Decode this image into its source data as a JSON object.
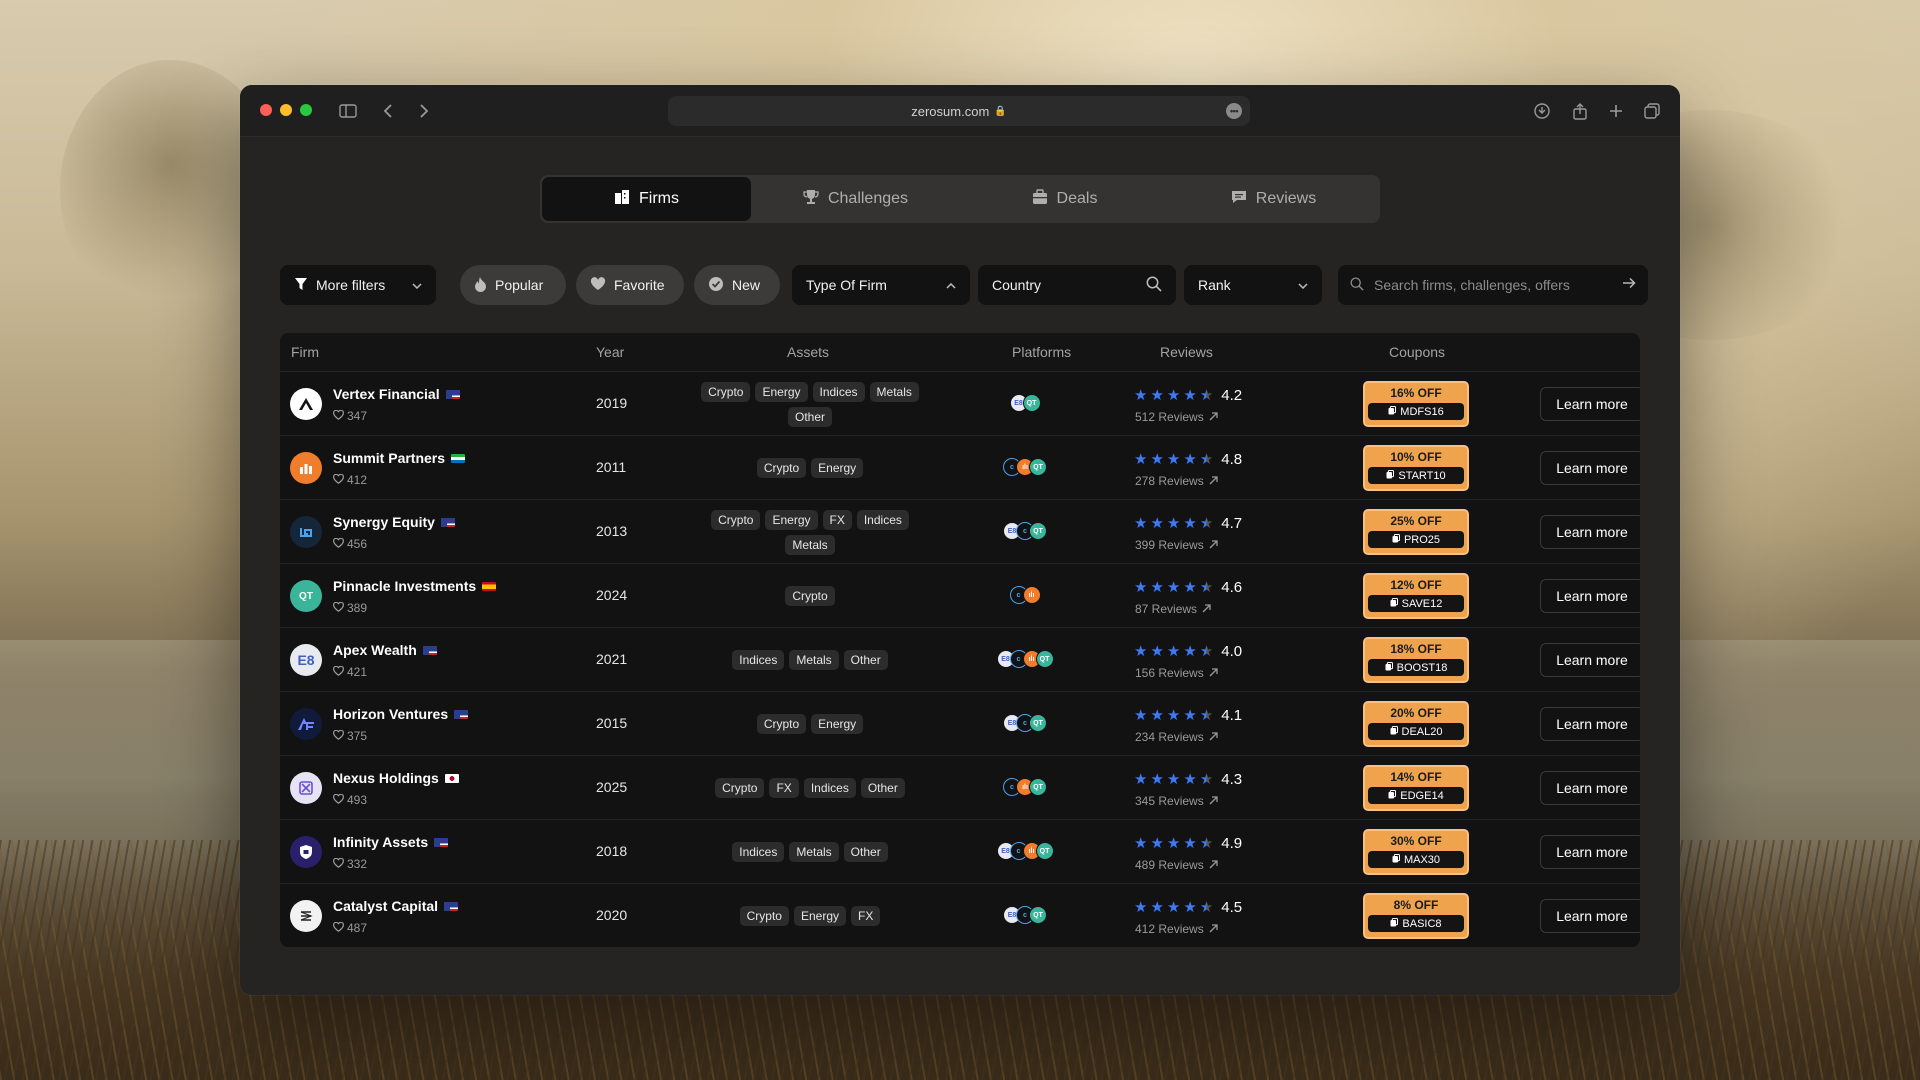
{
  "browser": {
    "url": "zerosum.com"
  },
  "tabs": [
    {
      "label": "Firms",
      "icon": "building-icon",
      "active": true
    },
    {
      "label": "Challenges",
      "icon": "trophy-icon",
      "active": false
    },
    {
      "label": "Deals",
      "icon": "briefcase-icon",
      "active": false
    },
    {
      "label": "Reviews",
      "icon": "chat-icon",
      "active": false
    }
  ],
  "filters": {
    "more_filters": "More filters",
    "popular": "Popular",
    "favorite": "Favorite",
    "new": "New",
    "type_of_firm": "Type Of Firm",
    "country": "Country",
    "rank": "Rank",
    "search_placeholder": "Search firms, challenges, offers"
  },
  "table": {
    "headers": {
      "firm": "Firm",
      "year": "Year",
      "assets": "Assets",
      "platforms": "Platforms",
      "reviews": "Reviews",
      "coupons": "Coupons"
    },
    "learn_more": "Learn more",
    "rows": [
      {
        "name": "Vertex Financial",
        "likes": "347",
        "year": "2019",
        "assets": [
          "Crypto",
          "Energy",
          "Indices",
          "Metals",
          "Other"
        ],
        "rating": "4.2",
        "reviews": "512 Reviews",
        "off": "16% OFF",
        "code": "MDFS16"
      },
      {
        "name": "Summit Partners",
        "likes": "412",
        "year": "2011",
        "assets": [
          "Crypto",
          "Energy"
        ],
        "rating": "4.8",
        "reviews": "278 Reviews",
        "off": "10% OFF",
        "code": "START10"
      },
      {
        "name": "Synergy Equity",
        "likes": "456",
        "year": "2013",
        "assets": [
          "Crypto",
          "Energy",
          "FX",
          "Indices",
          "Metals"
        ],
        "rating": "4.7",
        "reviews": "399 Reviews",
        "off": "25% OFF",
        "code": "PRO25"
      },
      {
        "name": "Pinnacle Investments",
        "likes": "389",
        "year": "2024",
        "assets": [
          "Crypto"
        ],
        "rating": "4.6",
        "reviews": "87 Reviews",
        "off": "12% OFF",
        "code": "SAVE12"
      },
      {
        "name": "Apex Wealth",
        "likes": "421",
        "year": "2021",
        "assets": [
          "Indices",
          "Metals",
          "Other"
        ],
        "rating": "4.0",
        "reviews": "156 Reviews",
        "off": "18% OFF",
        "code": "BOOST18"
      },
      {
        "name": "Horizon Ventures",
        "likes": "375",
        "year": "2015",
        "assets": [
          "Crypto",
          "Energy"
        ],
        "rating": "4.1",
        "reviews": "234 Reviews",
        "off": "20% OFF",
        "code": "DEAL20"
      },
      {
        "name": "Nexus Holdings",
        "likes": "493",
        "year": "2025",
        "assets": [
          "Crypto",
          "FX",
          "Indices",
          "Other"
        ],
        "rating": "4.3",
        "reviews": "345 Reviews",
        "off": "14% OFF",
        "code": "EDGE14"
      },
      {
        "name": "Infinity Assets",
        "likes": "332",
        "year": "2018",
        "assets": [
          "Indices",
          "Metals",
          "Other"
        ],
        "rating": "4.9",
        "reviews": "489 Reviews",
        "off": "30% OFF",
        "code": "MAX30"
      },
      {
        "name": "Catalyst Capital",
        "likes": "487",
        "year": "2020",
        "assets": [
          "Crypto",
          "Energy",
          "FX"
        ],
        "rating": "4.5",
        "reviews": "412 Reviews",
        "off": "8% OFF",
        "code": "BASIC8"
      }
    ]
  },
  "row_visuals": [
    {
      "logo_icon": "vertex-logo-icon",
      "logo_bg": "#ffffff",
      "flag": "us-flag-icon",
      "platforms": [
        "e8",
        "qt"
      ]
    },
    {
      "logo_icon": "summit-logo-icon",
      "logo_bg": "#f07d2b",
      "flag": "sl-flag-icon",
      "platforms": [
        "ct",
        "dx",
        "qt"
      ]
    },
    {
      "logo_icon": "synergy-logo-icon",
      "logo_bg": "#14263a",
      "flag": "us-flag-icon",
      "platforms": [
        "e8",
        "ct",
        "qt"
      ]
    },
    {
      "logo_icon": "pinnacle-logo-icon",
      "logo_bg": "#3bb59a",
      "flag": "es-flag-icon",
      "platforms": [
        "ct",
        "dx"
      ]
    },
    {
      "logo_icon": "apex-logo-icon",
      "logo_bg": "#e8eaf0",
      "flag": "us-flag-icon",
      "platforms": [
        "e8",
        "ct",
        "dx",
        "qt"
      ]
    },
    {
      "logo_icon": "horizon-logo-icon",
      "logo_bg": "#101a3a",
      "flag": "us-flag-icon",
      "platforms": [
        "e8",
        "ct",
        "qt"
      ]
    },
    {
      "logo_icon": "nexus-logo-icon",
      "logo_bg": "#e6e3f5",
      "flag": "jp-flag-icon",
      "platforms": [
        "ct",
        "dx",
        "qt"
      ]
    },
    {
      "logo_icon": "infinity-logo-icon",
      "logo_bg": "#2a1f6b",
      "flag": "us-flag-icon",
      "platforms": [
        "e8",
        "ct",
        "dx",
        "qt"
      ]
    },
    {
      "logo_icon": "catalyst-logo-icon",
      "logo_bg": "#f2f2f2",
      "flag": "us-flag-icon",
      "platforms": [
        "e8",
        "ct",
        "qt"
      ]
    }
  ],
  "colors": {
    "star": "#3d7bf6",
    "coupon": "#f0a34d",
    "active_tab": "#121212"
  }
}
